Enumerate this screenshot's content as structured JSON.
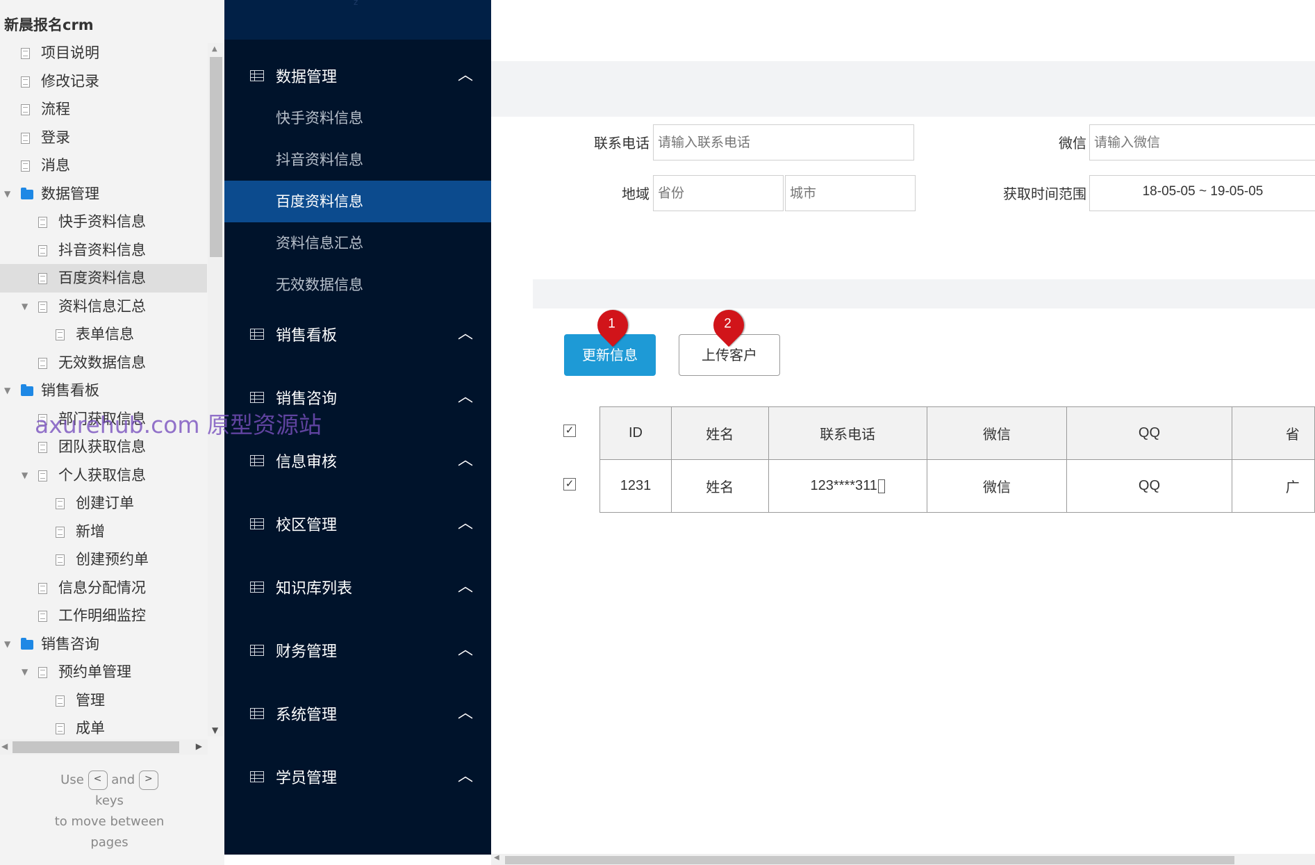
{
  "project_title": "新晨报名crm",
  "tree": [
    {
      "label": "项目说明",
      "level": 0,
      "kind": "page"
    },
    {
      "label": "修改记录",
      "level": 0,
      "kind": "page"
    },
    {
      "label": "流程",
      "level": 0,
      "kind": "page"
    },
    {
      "label": "登录",
      "level": 0,
      "kind": "page"
    },
    {
      "label": "消息",
      "level": 0,
      "kind": "page"
    },
    {
      "label": "数据管理",
      "level": 0,
      "kind": "folder",
      "expanded": true
    },
    {
      "label": "快手资料信息",
      "level": 1,
      "kind": "page"
    },
    {
      "label": "抖音资料信息",
      "level": 1,
      "kind": "page"
    },
    {
      "label": "百度资料信息",
      "level": 1,
      "kind": "page",
      "selected": true
    },
    {
      "label": "资料信息汇总",
      "level": 1,
      "kind": "page",
      "expanded": true
    },
    {
      "label": "表单信息",
      "level": 2,
      "kind": "page"
    },
    {
      "label": "无效数据信息",
      "level": 1,
      "kind": "page"
    },
    {
      "label": "销售看板",
      "level": 0,
      "kind": "folder",
      "expanded": true
    },
    {
      "label": "部门获取信息",
      "level": 1,
      "kind": "page"
    },
    {
      "label": "团队获取信息",
      "level": 1,
      "kind": "page"
    },
    {
      "label": "个人获取信息",
      "level": 1,
      "kind": "page",
      "expanded": true
    },
    {
      "label": "创建订单",
      "level": 2,
      "kind": "page"
    },
    {
      "label": "新增",
      "level": 2,
      "kind": "page"
    },
    {
      "label": "创建预约单",
      "level": 2,
      "kind": "page"
    },
    {
      "label": "信息分配情况",
      "level": 1,
      "kind": "page"
    },
    {
      "label": "工作明细监控",
      "level": 1,
      "kind": "page"
    },
    {
      "label": "销售咨询",
      "level": 0,
      "kind": "folder",
      "expanded": true
    },
    {
      "label": "预约单管理",
      "level": 1,
      "kind": "page",
      "expanded": true
    },
    {
      "label": "管理",
      "level": 2,
      "kind": "page"
    },
    {
      "label": "成单",
      "level": 2,
      "kind": "page"
    }
  ],
  "hint": {
    "use": "Use",
    "and": "and",
    "keys": "keys",
    "line2": "to move between",
    "line3": "pages",
    "key_prev": "<",
    "key_next": ">"
  },
  "watermark": "axurehub.com 原型资源站",
  "nav_top_glyph": "z",
  "nav": {
    "sections": [
      {
        "label": "数据管理",
        "items": [
          "快手资料信息",
          "抖音资料信息",
          "百度资料信息",
          "资料信息汇总",
          "无效数据信息"
        ],
        "active_item": 2
      },
      {
        "label": "销售看板"
      },
      {
        "label": "销售咨询"
      },
      {
        "label": "信息审核"
      },
      {
        "label": "校区管理"
      },
      {
        "label": "知识库列表"
      },
      {
        "label": "财务管理"
      },
      {
        "label": "系统管理"
      },
      {
        "label": "学员管理"
      }
    ]
  },
  "filters": {
    "phone_label": "联系电话",
    "phone_placeholder": "请输入联系电话",
    "wechat_label": "微信",
    "wechat_placeholder": "请输入微信",
    "region_label": "地域",
    "province_placeholder": "省份",
    "city_placeholder": "城市",
    "time_label": "获取时间范围",
    "date_range": "18-05-05  ~  19-05-05"
  },
  "buttons": {
    "update": "更新信息",
    "upload": "上传客户"
  },
  "markers": [
    "1",
    "2"
  ],
  "table": {
    "columns": [
      "ID",
      "姓名",
      "联系电话",
      "微信",
      "QQ",
      "省"
    ],
    "rows": [
      [
        "1231",
        "姓名",
        "123****311",
        "微信",
        "QQ",
        "广"
      ]
    ]
  }
}
